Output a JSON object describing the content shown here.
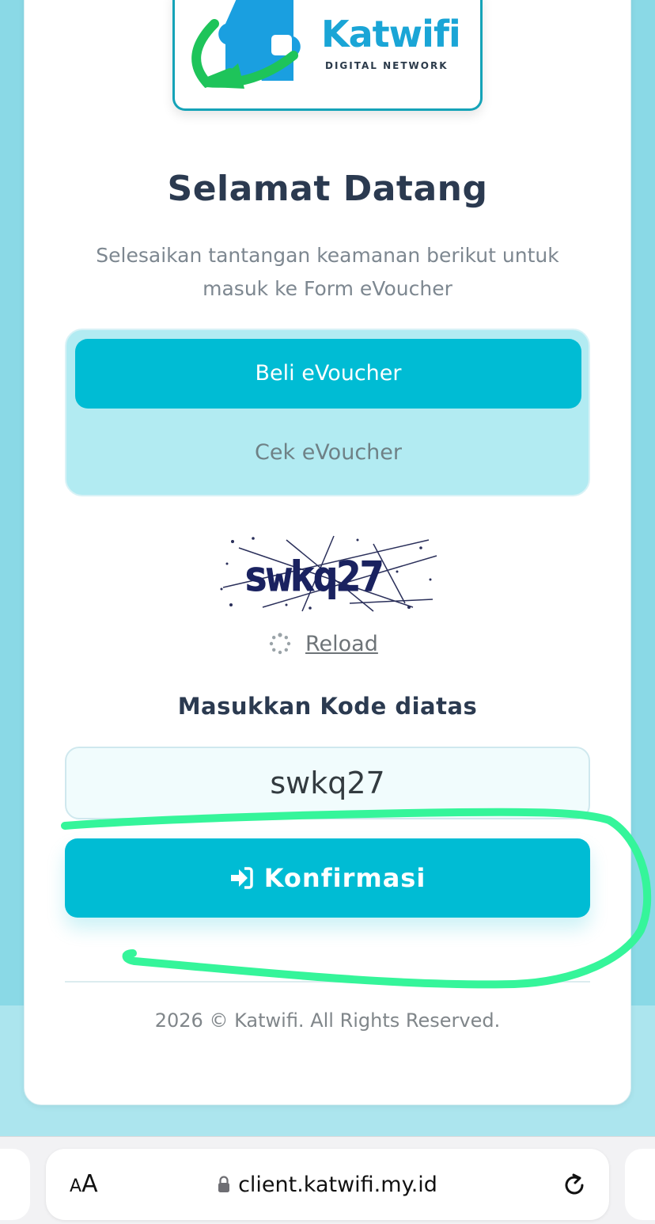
{
  "brand": {
    "name": "Katwifi",
    "tagline": "DIGITAL NETWORK"
  },
  "header": {
    "title": "Selamat Datang",
    "subtitle": "Selesaikan tantangan keamanan berikut untuk masuk ke Form eVoucher"
  },
  "tabs": {
    "items": [
      {
        "label": "Beli eVoucher",
        "active": true
      },
      {
        "label": "Cek eVoucher",
        "active": false
      }
    ]
  },
  "captcha": {
    "text": "swkq27",
    "reload_label": "Reload"
  },
  "form": {
    "code_label": "Masukkan Kode diatas",
    "code_value": "swkq27",
    "confirm_label": "Konfirmasi"
  },
  "footer": {
    "text": "2026 © Katwifi. All Rights Reserved."
  },
  "browser": {
    "aa_small": "A",
    "aa_large": "A",
    "url": "client.katwifi.my.id"
  },
  "colors": {
    "accent": "#00bcd4",
    "tab_bg": "#b2ebf2",
    "title": "#2b3a50",
    "page_bg": "#8ad9e6",
    "annotation": "#35f59a"
  },
  "icons": {
    "logo": "katwifi-logo",
    "reload": "spinner-icon",
    "confirm": "sign-in-icon",
    "lock": "lock-icon",
    "refresh": "refresh-icon"
  }
}
